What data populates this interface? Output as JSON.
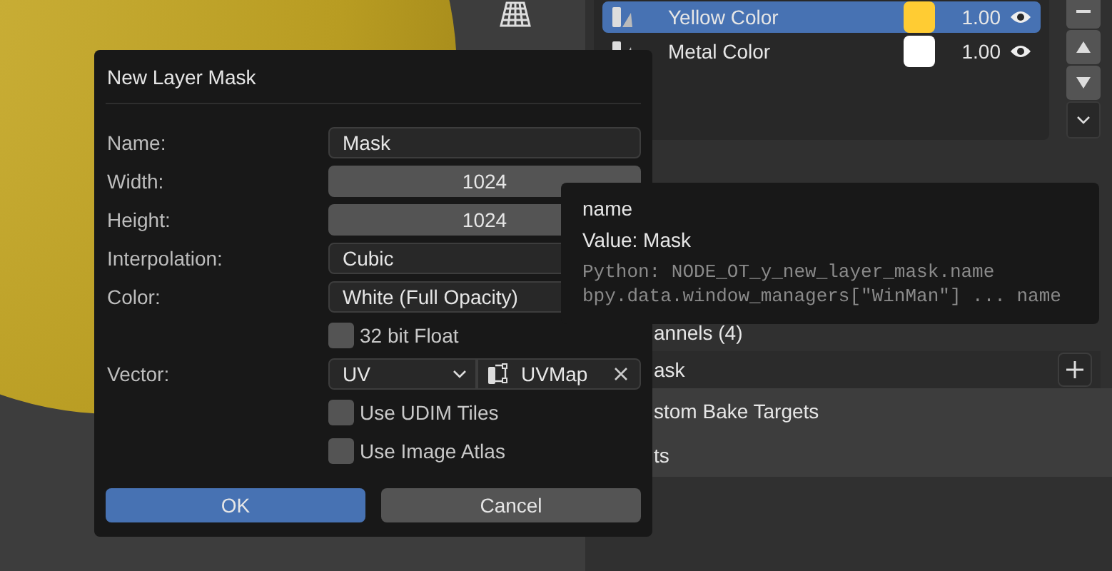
{
  "layers": [
    {
      "name": "Yellow Color",
      "color": "#ffcc33",
      "value": "1.00",
      "selected": true
    },
    {
      "name": "Metal Color",
      "color": "#ffffff",
      "value": "1.00",
      "selected": false
    }
  ],
  "panel_rows": [
    {
      "label": "annels (4)",
      "kind": "plain"
    },
    {
      "label": "ask",
      "kind": "add"
    },
    {
      "label": "stom Bake Targets",
      "kind": "section"
    },
    {
      "label": "ts",
      "kind": "section"
    }
  ],
  "dialog": {
    "title": "New Layer Mask",
    "fields": [
      {
        "label": "Name:",
        "kind": "text",
        "value": "Mask"
      },
      {
        "label": "Width:",
        "kind": "number",
        "value": "1024"
      },
      {
        "label": "Height:",
        "kind": "number",
        "value": "1024"
      },
      {
        "label": "Interpolation:",
        "kind": "dropdown",
        "value": "Cubic"
      },
      {
        "label": "Color:",
        "kind": "dropdown",
        "value": "White (Full Opacity)"
      },
      {
        "label": "32 bit Float",
        "kind": "checkbox",
        "checked": false
      },
      {
        "label": "Vector:",
        "kind": "vector",
        "value": "UV",
        "map": "UVMap"
      },
      {
        "label": "Use UDIM Tiles",
        "kind": "checkbox",
        "checked": false
      },
      {
        "label": "Use Image Atlas",
        "kind": "checkbox",
        "checked": false
      }
    ],
    "buttons": [
      {
        "label": "OK",
        "primary": true
      },
      {
        "label": "Cancel",
        "primary": false
      }
    ]
  },
  "tooltip": {
    "title": "name",
    "value": "Value: Mask",
    "python": [
      "Python: NODE_OT_y_new_layer_mask.name",
      "bpy.data.window_managers[\"WinMan\"] ... name"
    ]
  }
}
